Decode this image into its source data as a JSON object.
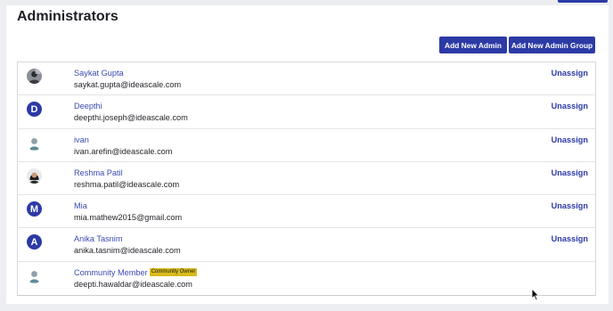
{
  "page_title": "Administrators",
  "buttons": {
    "add_admin": "Add New Admin",
    "add_admin_group": "Add New Admin Group"
  },
  "colors": {
    "accent": "#2c3aa6",
    "link": "#3a4bb0",
    "badge": "#d8bb1c"
  },
  "admins": [
    {
      "avatar_type": "photo-man",
      "avatar_letter": "",
      "name": "Saykat Gupta",
      "badge": "",
      "email": "saykat.gupta@ideascale.com",
      "action": "Unassign"
    },
    {
      "avatar_type": "letter",
      "avatar_letter": "D",
      "name": "Deepthi",
      "badge": "",
      "email": "deepthi.joseph@ideascale.com",
      "action": "Unassign"
    },
    {
      "avatar_type": "default-user",
      "avatar_letter": "",
      "name": "ivan",
      "badge": "",
      "email": "ivan.arefin@ideascale.com",
      "action": "Unassign"
    },
    {
      "avatar_type": "photo-woman",
      "avatar_letter": "",
      "name": "Reshma Patil",
      "badge": "",
      "email": "reshma.patil@ideascale.com",
      "action": "Unassign"
    },
    {
      "avatar_type": "letter",
      "avatar_letter": "M",
      "name": "Mia",
      "badge": "",
      "email": "mia.mathew2015@gmail.com",
      "action": "Unassign"
    },
    {
      "avatar_type": "letter",
      "avatar_letter": "A",
      "name": "Anika Tasnim",
      "badge": "",
      "email": "anika.tasnim@ideascale.com",
      "action": "Unassign"
    },
    {
      "avatar_type": "default-user",
      "avatar_letter": "",
      "name": "Community Member",
      "badge": "Community Owner",
      "email": "deepti.hawaldar@ideascale.com",
      "action": ""
    }
  ]
}
